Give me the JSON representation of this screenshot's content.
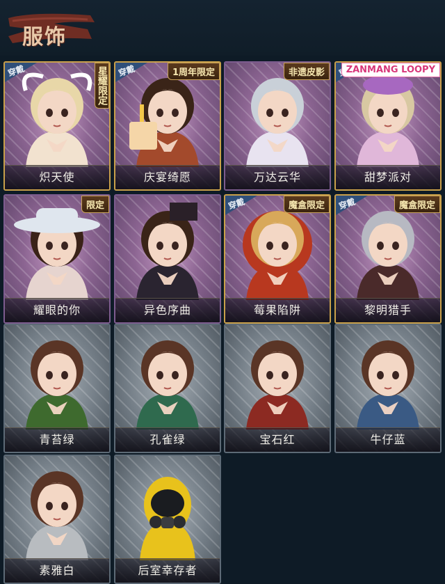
{
  "header": {
    "title": "服饰"
  },
  "colors": {
    "background": "#0e1b26",
    "gold_frame": "#c9a04a",
    "purple_frame": "#7d5c8f",
    "grey_frame": "#5d6a76",
    "title_banner": "#7a2f22"
  },
  "costumes": [
    {
      "name": "炽天使",
      "tier": "gold",
      "wear_badge": "穿戴",
      "tag": "星耀限定",
      "tag_style": "vertical",
      "icon": "angel-portrait-icon"
    },
    {
      "name": "庆宴绮愿",
      "tier": "gold",
      "wear_badge": "穿戴",
      "tag": "1周年限定",
      "tag_style": "normal",
      "icon": "cake-portrait-icon"
    },
    {
      "name": "万达云华",
      "tier": "purple",
      "wear_badge": "",
      "tag": "非遗皮影",
      "tag_style": "normal",
      "icon": "silver-hair-portrait-icon"
    },
    {
      "name": "甜梦派对",
      "tier": "gold",
      "wear_badge": "穿戴",
      "tag": "ZANMANG LOOPY",
      "tag_style": "loopy",
      "icon": "party-portrait-icon"
    },
    {
      "name": "耀眼的你",
      "tier": "purple",
      "wear_badge": "",
      "tag": "限定",
      "tag_style": "normal",
      "icon": "cowboy-hat-portrait-icon"
    },
    {
      "name": "异色序曲",
      "tier": "purple",
      "wear_badge": "",
      "tag": "",
      "tag_style": "normal",
      "icon": "top-hat-portrait-icon"
    },
    {
      "name": "莓果陷阱",
      "tier": "gold",
      "wear_badge": "穿戴",
      "tag": "魔盒限定",
      "tag_style": "normal",
      "icon": "red-hood-portrait-icon"
    },
    {
      "name": "黎明猎手",
      "tier": "gold",
      "wear_badge": "穿戴",
      "tag": "魔盒限定",
      "tag_style": "normal",
      "icon": "hunter-portrait-icon"
    },
    {
      "name": "青苔绿",
      "tier": "grey",
      "wear_badge": "",
      "tag": "",
      "tag_style": "normal",
      "icon": "girl-green-portrait-icon"
    },
    {
      "name": "孔雀绿",
      "tier": "grey",
      "wear_badge": "",
      "tag": "",
      "tag_style": "normal",
      "icon": "girl-teal-portrait-icon"
    },
    {
      "name": "宝石红",
      "tier": "grey",
      "wear_badge": "",
      "tag": "",
      "tag_style": "normal",
      "icon": "girl-red-portrait-icon"
    },
    {
      "name": "牛仔蓝",
      "tier": "grey",
      "wear_badge": "",
      "tag": "",
      "tag_style": "normal",
      "icon": "girl-blue-portrait-icon"
    },
    {
      "name": "素雅白",
      "tier": "grey",
      "wear_badge": "",
      "tag": "",
      "tag_style": "normal",
      "icon": "girl-white-portrait-icon"
    },
    {
      "name": "后室幸存者",
      "tier": "grey",
      "wear_badge": "",
      "tag": "",
      "tag_style": "normal",
      "icon": "gas-mask-portrait-icon"
    }
  ]
}
